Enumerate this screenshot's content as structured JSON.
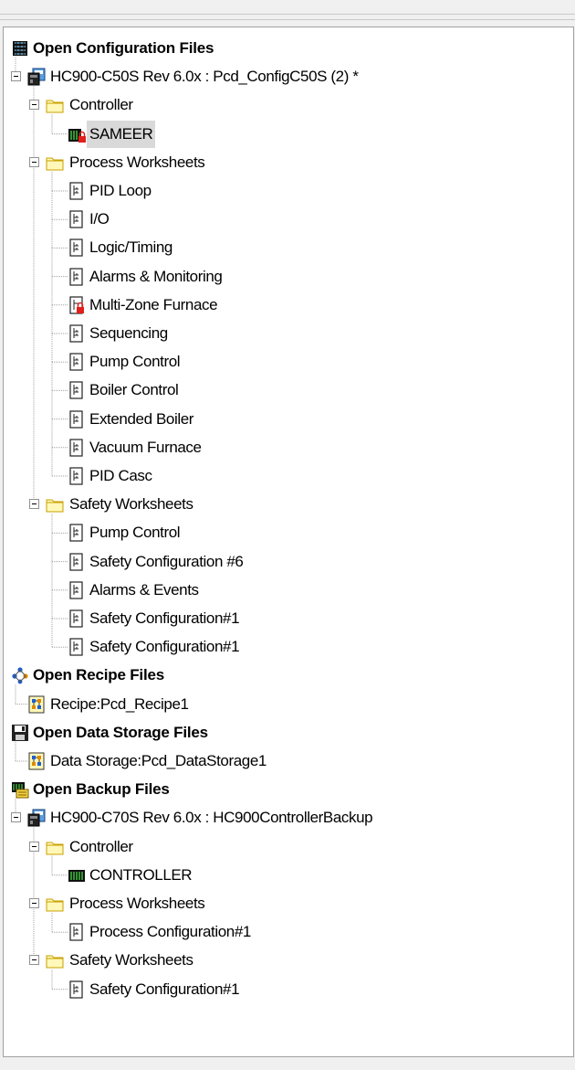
{
  "tree": [
    {
      "id": "cfg-root",
      "label": "Open Configuration Files",
      "level": 0,
      "bold": true,
      "icon": "configuration-files-icon"
    },
    {
      "id": "c50s",
      "label": "HC900-C50S Rev 6.0x : Pcd_ConfigC50S (2) *",
      "level": 1,
      "expander": true,
      "icon": "controller-device-icon"
    },
    {
      "id": "c50s-controller",
      "label": "Controller",
      "level": 2,
      "expander": true,
      "icon": "folder-icon"
    },
    {
      "id": "sameer",
      "label": "SAMEER",
      "level": 3,
      "selected": true,
      "icon": "locked-controller-icon"
    },
    {
      "id": "c50s-process",
      "label": "Process Worksheets",
      "level": 2,
      "expander": true,
      "icon": "folder-icon"
    },
    {
      "id": "pid-loop",
      "label": "PID Loop",
      "level": 3,
      "icon": "worksheet-icon"
    },
    {
      "id": "io",
      "label": "I/O",
      "level": 3,
      "icon": "worksheet-icon"
    },
    {
      "id": "logic-timing",
      "label": "Logic/Timing",
      "level": 3,
      "icon": "worksheet-icon"
    },
    {
      "id": "alarms-monitoring",
      "label": "Alarms & Monitoring",
      "level": 3,
      "icon": "worksheet-icon"
    },
    {
      "id": "multi-zone",
      "label": "Multi-Zone Furnace",
      "level": 3,
      "icon": "locked-worksheet-icon"
    },
    {
      "id": "sequencing",
      "label": "Sequencing",
      "level": 3,
      "icon": "worksheet-icon"
    },
    {
      "id": "pump-control",
      "label": "Pump Control",
      "level": 3,
      "icon": "worksheet-icon"
    },
    {
      "id": "boiler-control",
      "label": "Boiler Control",
      "level": 3,
      "icon": "worksheet-icon"
    },
    {
      "id": "extended-boiler",
      "label": "Extended Boiler",
      "level": 3,
      "icon": "worksheet-icon"
    },
    {
      "id": "vacuum-furnace",
      "label": "Vacuum Furnace",
      "level": 3,
      "icon": "worksheet-icon"
    },
    {
      "id": "pid-casc",
      "label": "PID Casc",
      "level": 3,
      "icon": "worksheet-icon"
    },
    {
      "id": "c50s-safety",
      "label": "Safety Worksheets",
      "level": 2,
      "expander": true,
      "icon": "folder-icon"
    },
    {
      "id": "safety-pump",
      "label": "Pump Control",
      "level": 3,
      "icon": "worksheet-icon"
    },
    {
      "id": "safety-cfg6",
      "label": "Safety Configuration #6",
      "level": 3,
      "icon": "worksheet-icon"
    },
    {
      "id": "alarms-events",
      "label": "Alarms & Events",
      "level": 3,
      "icon": "worksheet-icon"
    },
    {
      "id": "safety-cfg1a",
      "label": "Safety Configuration#1",
      "level": 3,
      "icon": "worksheet-icon"
    },
    {
      "id": "safety-cfg1b",
      "label": "Safety Configuration#1",
      "level": 3,
      "icon": "worksheet-icon"
    },
    {
      "id": "recipe-root",
      "label": "Open Recipe Files",
      "level": 0,
      "bold": true,
      "icon": "recipe-files-icon"
    },
    {
      "id": "recipe1",
      "label": "Recipe:Pcd_Recipe1",
      "level": 1,
      "icon": "recipe-document-icon"
    },
    {
      "id": "data-root",
      "label": "Open Data Storage Files",
      "level": 0,
      "bold": true,
      "icon": "floppy-disk-icon"
    },
    {
      "id": "datastorage1",
      "label": "Data Storage:Pcd_DataStorage1",
      "level": 1,
      "icon": "data-storage-document-icon"
    },
    {
      "id": "backup-root",
      "label": "Open Backup Files",
      "level": 0,
      "bold": true,
      "icon": "backup-files-icon"
    },
    {
      "id": "c70s",
      "label": "HC900-C70S Rev 6.0x : HC900ControllerBackup",
      "level": 1,
      "expander": true,
      "icon": "controller-device-icon"
    },
    {
      "id": "c70s-controller",
      "label": "Controller",
      "level": 2,
      "expander": true,
      "icon": "folder-icon"
    },
    {
      "id": "controller-node",
      "label": "CONTROLLER",
      "level": 3,
      "icon": "controller-icon"
    },
    {
      "id": "c70s-process",
      "label": "Process Worksheets",
      "level": 2,
      "expander": true,
      "icon": "folder-icon"
    },
    {
      "id": "process-cfg1",
      "label": "Process Configuration#1",
      "level": 3,
      "icon": "worksheet-icon"
    },
    {
      "id": "c70s-safety",
      "label": "Safety Worksheets",
      "level": 2,
      "expander": true,
      "icon": "folder-icon"
    },
    {
      "id": "safety-cfg1c",
      "label": "Safety Configuration#1",
      "level": 3,
      "icon": "worksheet-icon"
    }
  ],
  "colors": {
    "folder": "#fff8b8",
    "folder_border": "#c8a000",
    "lock": "#e0201c",
    "selection": "#d9d9d9",
    "tree_lines": "#a0a0a0"
  }
}
